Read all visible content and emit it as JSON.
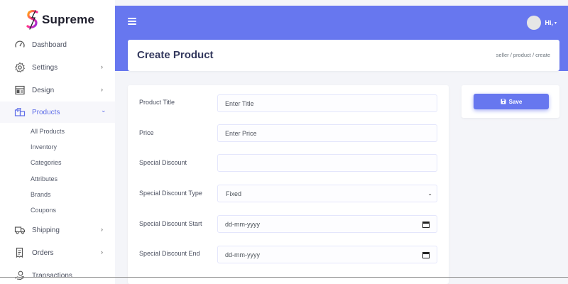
{
  "brand": {
    "name": "Supreme",
    "accent": "#6777ef",
    "logo_colors": [
      "#ff2d95",
      "#ffb300"
    ]
  },
  "sidebar": {
    "items": [
      {
        "label": "Dashboard",
        "icon": "gauge-icon",
        "chevron": ""
      },
      {
        "label": "Settings",
        "icon": "gear-icon",
        "chevron": "›"
      },
      {
        "label": "Design",
        "icon": "layout-icon",
        "chevron": "›"
      },
      {
        "label": "Products",
        "icon": "boxes-icon",
        "chevron": "⌄",
        "active": true
      },
      {
        "label": "Shipping",
        "icon": "truck-icon",
        "chevron": "›"
      },
      {
        "label": "Orders",
        "icon": "receipt-icon",
        "chevron": "›"
      },
      {
        "label": "Transactions",
        "icon": "hand-coin-icon",
        "chevron": ""
      }
    ],
    "products_sub": [
      "All Products",
      "Inventory",
      "Categories",
      "Attributes",
      "Brands",
      "Coupons"
    ]
  },
  "header": {
    "user_greeting": "Hi,",
    "user_caret": "▾"
  },
  "page": {
    "title": "Create Product",
    "breadcrumb": "seller  /  product  /  create"
  },
  "form": {
    "product_title": {
      "label": "Product Title",
      "placeholder": "Enter Title",
      "value": ""
    },
    "price": {
      "label": "Price",
      "placeholder": "Enter Price",
      "value": ""
    },
    "special_discount": {
      "label": "Special Discount",
      "placeholder": "",
      "value": ""
    },
    "special_discount_type": {
      "label": "Special Discount Type",
      "value": "Fixed"
    },
    "special_discount_start": {
      "label": "Special Discount Start",
      "value": "dd-mm-yyyy"
    },
    "special_discount_end": {
      "label": "Special Discount End",
      "value": "dd-mm-yyyy"
    }
  },
  "actions": {
    "save_label": "Save"
  }
}
